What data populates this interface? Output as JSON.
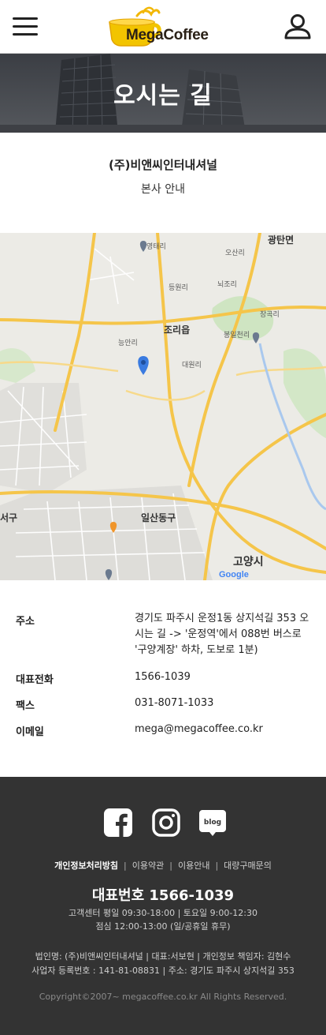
{
  "header": {
    "logo_text": "MegaCoffee",
    "menu_icon": "hamburger-menu-icon",
    "user_icon": "user-icon"
  },
  "hero": {
    "title": "오시는 길"
  },
  "company": {
    "name": "(주)비앤씨인터내셔널",
    "subtitle": "본사 안내"
  },
  "map": {
    "labels": {
      "gwangtan": "광탄면",
      "yeongtae": "영태리",
      "osan": "오산리",
      "deungwon": "등원리",
      "noejo": "뇌조리",
      "jangkok": "장곡리",
      "bongilcheon": "봉일천리",
      "jori": "조리읍",
      "neungan": "능안리",
      "daewon": "대원리",
      "ilsan_dong": "일산동구",
      "seogu": "서구",
      "goyang": "고양시"
    },
    "google": "Google"
  },
  "info": {
    "address_label": "주소",
    "address_value": "경기도 파주시 운정1동 상지석길 353 오시는 길 -> '운정역'에서 088번 버스로 '구양계장' 하차, 도보로 1분)",
    "phone_label": "대표전화",
    "phone_value": "1566-1039",
    "fax_label": "팩스",
    "fax_value": "031-8071-1033",
    "email_label": "이메일",
    "email_value": "mega@megacoffee.co.kr"
  },
  "footer": {
    "social": [
      "facebook-icon",
      "instagram-icon",
      "blog-icon"
    ],
    "blog_text": "blog",
    "links": [
      "개인정보처리방침",
      "이용약관",
      "이용안내",
      "대량구매문의"
    ],
    "separator": "|",
    "rep_number": "대표번호 1566-1039",
    "hours_line1": "고객센터 평일 09:30-18:00 | 토요일 9:00-12:30",
    "hours_line2": "점심 12:00-13:00 (일/공휴일 휴무)",
    "corp_line1": "법인명: (주)비앤씨인터내셔널 | 대표:서보현 | 개인정보 책임자: 김현수",
    "corp_line2": "사업자 등록번호 : 141-81-08831 | 주소: 경기도 파주시 상지석길 353",
    "copyright": "Copyright©2007~ megacoffee.co.kr All Rights Reserved."
  }
}
